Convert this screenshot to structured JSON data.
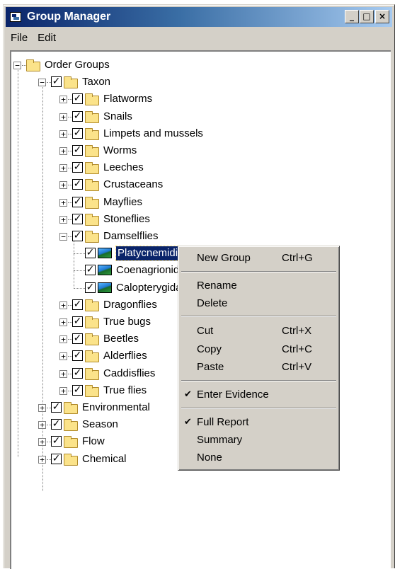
{
  "window": {
    "title": "Group Manager",
    "minimize": "_",
    "maximize": "□",
    "close": "×"
  },
  "menubar": {
    "file": "File",
    "edit": "Edit"
  },
  "tree": {
    "expand_glyph": "+",
    "collapse_glyph": "−",
    "check_glyph": "✓",
    "root": "Order Groups",
    "taxon": "Taxon",
    "taxon_children": [
      "Flatworms",
      "Snails",
      "Limpets and mussels",
      "Worms",
      "Leeches",
      "Crustaceans",
      "Mayflies",
      "Stoneflies",
      "Damselflies"
    ],
    "damselfly_children": [
      "Platycnemididae",
      "Coenagrionidae",
      "Calopterygidae"
    ],
    "taxon_children_after": [
      "Dragonflies",
      "True bugs",
      "Beetles",
      "Alderflies",
      "Caddisflies",
      "True flies"
    ],
    "root_children_after": [
      "Environmental",
      "Season",
      "Flow",
      "Chemical"
    ]
  },
  "context_menu": {
    "new_group": "New Group",
    "new_group_shortcut": "Ctrl+G",
    "rename": "Rename",
    "delete": "Delete",
    "cut": "Cut",
    "cut_shortcut": "Ctrl+X",
    "copy": "Copy",
    "copy_shortcut": "Ctrl+C",
    "paste": "Paste",
    "paste_shortcut": "Ctrl+V",
    "enter_evidence": "Enter Evidence",
    "full_report": "Full Report",
    "summary": "Summary",
    "none": "None",
    "checkmark": "✔"
  },
  "colors": {
    "selection": "#0a246a",
    "title_gradient_start": "#0a246a",
    "title_gradient_end": "#a6caf0",
    "chrome": "#d4d0c8"
  }
}
